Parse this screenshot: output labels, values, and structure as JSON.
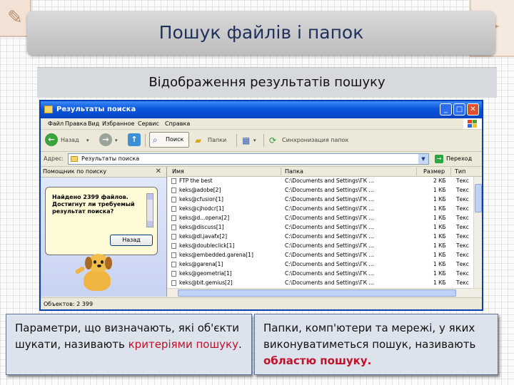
{
  "slide": {
    "title": "Пошук файлів і папок",
    "subtitle": "Відображення результатів пошуку"
  },
  "window": {
    "title": "Результаты поиска",
    "menu": [
      "Файл",
      "Правка",
      "Вид",
      "Избранное",
      "Сервис",
      "Справка"
    ],
    "toolbar": {
      "back_label": "Назад",
      "search_label": "Поиск",
      "folders_label": "Папки",
      "sync_label": "Синхронизация папок"
    },
    "address": {
      "label": "Адрес:",
      "value": "Результаты поиска",
      "go_label": "Переход"
    },
    "search_pane": {
      "header": "Помощник по поиску",
      "message": "Найдено 2399 файлов. Достигнут ли требуемый результат поиска?",
      "back_button": "Назад"
    },
    "columns": [
      "Имя",
      "Папка",
      "Размер",
      "Тип"
    ],
    "files": [
      {
        "name": "FTP the best",
        "folder": "C:\\Documents and Settings\\ГК ...",
        "size": "2 КБ",
        "type": "Текс"
      },
      {
        "name": "keks@adobe[2]",
        "folder": "C:\\Documents and Settings\\ГК ...",
        "size": "1 КБ",
        "type": "Текс"
      },
      {
        "name": "keks@cfusion[1]",
        "folder": "C:\\Documents and Settings\\ГК ...",
        "size": "1 КБ",
        "type": "Текс"
      },
      {
        "name": "keks@cjhodcr[1]",
        "folder": "C:\\Documents and Settings\\ГК ...",
        "size": "1 КБ",
        "type": "Текс"
      },
      {
        "name": "keks@d...openx[2]",
        "folder": "C:\\Documents and Settings\\ГК ...",
        "size": "1 КБ",
        "type": "Текс"
      },
      {
        "name": "keks@discuss[1]",
        "folder": "C:\\Documents and Settings\\ГК ...",
        "size": "1 КБ",
        "type": "Текс"
      },
      {
        "name": "keks@dl.javafx[2]",
        "folder": "C:\\Documents and Settings\\ГК ...",
        "size": "1 КБ",
        "type": "Текс"
      },
      {
        "name": "keks@doubleclick[1]",
        "folder": "C:\\Documents and Settings\\ГК ...",
        "size": "1 КБ",
        "type": "Текс"
      },
      {
        "name": "keks@embedded.garena[1]",
        "folder": "C:\\Documents and Settings\\ГК ...",
        "size": "1 КБ",
        "type": "Текс"
      },
      {
        "name": "keks@garena[1]",
        "folder": "C:\\Documents and Settings\\ГК ...",
        "size": "1 КБ",
        "type": "Текс"
      },
      {
        "name": "keks@geometria[1]",
        "folder": "C:\\Documents and Settings\\ГК ...",
        "size": "1 КБ",
        "type": "Текс"
      },
      {
        "name": "keks@bit.gemius[2]",
        "folder": "C:\\Documents and Settings\\ГК ...",
        "size": "1 КБ",
        "type": "Текс"
      }
    ],
    "status": "Объектов: 2 399"
  },
  "captions": {
    "left_text": "Параметри, що визначають, які об'єкти шукати, називають",
    "left_term": "критеріями пошуку",
    "left_end": ".",
    "right_text": "Папки, комп'ютери та мережі, у яких виконуватиметься пошук, називають",
    "right_term": "областю пошуку."
  },
  "colors": {
    "title_text": "#20315e",
    "highlight": "#c0102a",
    "xp_blue": "#0a56dc"
  }
}
